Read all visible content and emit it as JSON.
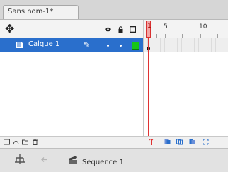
{
  "document_tab": {
    "title": "Sans nom-1*"
  },
  "timeline": {
    "ruler_labels": [
      "1",
      "5",
      "10"
    ],
    "layers": [
      {
        "name": "Calque 1",
        "selected": true,
        "color": "#17c517"
      }
    ],
    "playhead_frame": "1"
  },
  "editbar": {
    "scene": "Séquence 1"
  },
  "colors": {
    "selection": "#2a6fcc",
    "playhead": "#e03333",
    "layer_swatch": "#17c517"
  }
}
